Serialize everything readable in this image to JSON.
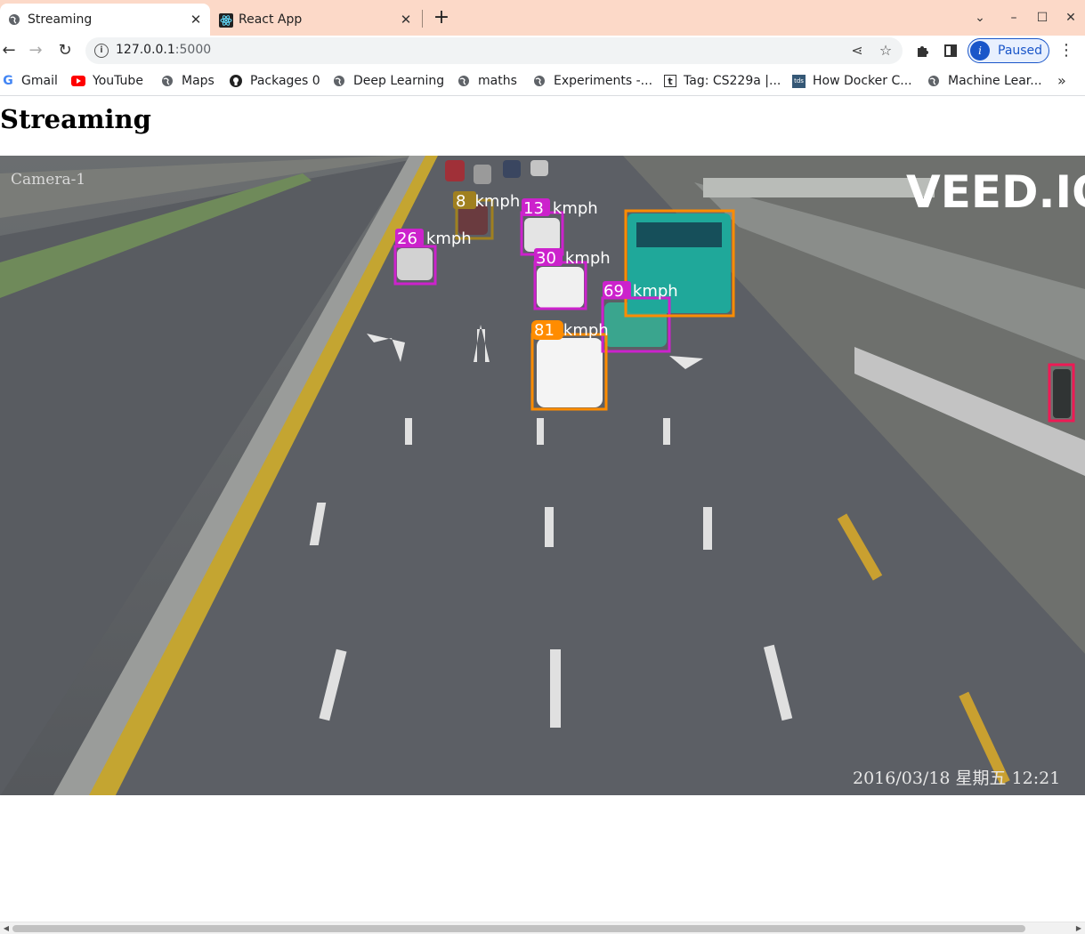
{
  "tabs": [
    {
      "title": "Streaming",
      "favicon": "globe-icon",
      "active": true
    },
    {
      "title": "React App",
      "favicon": "react-icon",
      "active": false
    }
  ],
  "toolbar": {
    "url_host": "127.0.0.1",
    "url_port": ":5000",
    "profile_initial": "i",
    "profile_status": "Paused"
  },
  "bookmarks": [
    {
      "label": "Gmail",
      "icon": "google-icon"
    },
    {
      "label": "YouTube",
      "icon": "youtube-icon"
    },
    {
      "label": "Maps",
      "icon": "globe-icon"
    },
    {
      "label": "Packages 0",
      "icon": "github-icon"
    },
    {
      "label": "Deep Learning",
      "icon": "globe-icon"
    },
    {
      "label": "maths",
      "icon": "globe-icon"
    },
    {
      "label": "Experiments -...",
      "icon": "globe-icon"
    },
    {
      "label": "Tag: CS229a |...",
      "icon": "tumblr-icon"
    },
    {
      "label": "How Docker C...",
      "icon": "tds-icon"
    },
    {
      "label": "Machine Lear...",
      "icon": "globe-icon"
    }
  ],
  "page": {
    "heading": "Streaming"
  },
  "video": {
    "camera_label": "Camera-1",
    "watermark": "VEED.IO",
    "timestamp": "2016/03/18 星期五 12:21",
    "detections": [
      {
        "speed": "8",
        "unit": "kmph",
        "color": "#a08020"
      },
      {
        "speed": "13",
        "unit": "kmph",
        "color": "#cc22cc"
      },
      {
        "speed": "26",
        "unit": "kmph",
        "color": "#cc22cc"
      },
      {
        "speed": "30",
        "unit": "kmph",
        "color": "#cc22cc"
      },
      {
        "speed": "69",
        "unit": "kmph",
        "color": "#cc22cc"
      },
      {
        "speed": "81",
        "unit": "kmph",
        "color": "#ff8c00"
      }
    ],
    "bus_box_color": "#ff8c00",
    "person_box_color": "#ee1a55"
  }
}
